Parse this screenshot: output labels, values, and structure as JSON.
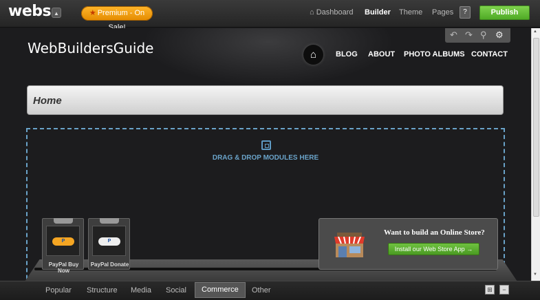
{
  "topbar": {
    "logo": "webs",
    "premium_label": "Premium - On Sale!",
    "nav": [
      {
        "label": "Dashboard"
      },
      {
        "label": "Builder"
      },
      {
        "label": "Theme"
      },
      {
        "label": "Pages"
      }
    ],
    "help_label": "?",
    "publish_label": "Publish"
  },
  "site": {
    "title": "WebBuildersGuide",
    "nav": [
      "BLOG",
      "ABOUT",
      "PHOTO ALBUMS",
      "CONTACT"
    ],
    "page_title": "Home"
  },
  "dropzone": {
    "text": "DRAG & DROP MODULES HERE"
  },
  "modules": [
    {
      "label": "PayPal Buy Now",
      "badge": "P",
      "color": "#f5a623"
    },
    {
      "label": "PayPal Donate",
      "badge": "P",
      "color": "#eeeeee"
    }
  ],
  "store_promo": {
    "title": "Want to build an Online Store?",
    "button_label": "Install our Web Store App →"
  },
  "bottom_tabs": [
    "Popular",
    "Structure",
    "Media",
    "Social",
    "Commerce",
    "Other"
  ],
  "active_tab": "Commerce",
  "colors": {
    "accent": "#6aa3c9",
    "publish": "#5cb531",
    "premium": "#f09a10"
  }
}
